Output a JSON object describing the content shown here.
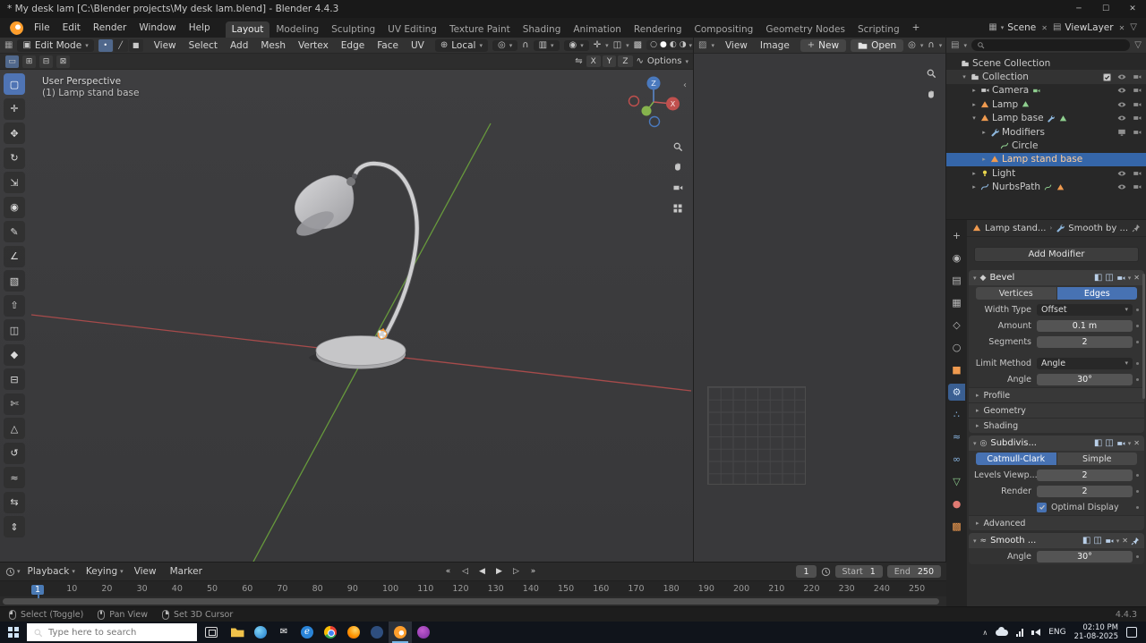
{
  "window": {
    "title": "* My desk lam [C:\\Blender projects\\My desk lam.blend] - Blender 4.4.3"
  },
  "glyphs": {
    "chevron": "▾",
    "expander-closed": "▸",
    "expander-open": "▾",
    "breadcrumb-sep": "›",
    "plus": "+",
    "close": "✕",
    "minimize": "─",
    "maximize": "☐",
    "panel-collapse": "‹",
    "caret-up": "∧",
    "filter": "▽",
    "editor-grid": "▦",
    "mode-cube": "▣",
    "vertex-mode": "•",
    "edge-mode": "╱",
    "face-mode": "■",
    "orientation": "⊕",
    "pivot": "◎",
    "magnet": "∩",
    "snap-target": "▥",
    "proportional": "◉",
    "gizmo": "✛",
    "overlays": "◫",
    "xray": "▩",
    "shade-wire": "○",
    "shade-solid": "●",
    "shade-material": "◐",
    "shade-render": "◑",
    "image-editor": "▨",
    "outliner-ic": "▤",
    "sel-new": "▭",
    "sel-extend": "⊞",
    "sel-subtract": "⊟",
    "sel-invert": "⊠",
    "mirror": "⇋",
    "snap-wave": "∿",
    "tab-tool": "+",
    "tab-render": "◉",
    "tab-output": "▤",
    "tab-view-layer": "▦",
    "tab-scene": "◇",
    "tab-world": "○",
    "tab-object": "■",
    "tab-modifiers": "⚙",
    "tab-particles": "∴",
    "tab-physics": "≈",
    "tab-constraints": "∞",
    "tab-data": "▽",
    "tab-material": "●",
    "tab-texture": "▩",
    "tool-box-select": "▢",
    "tool-cursor": "✛",
    "tool-move": "✥",
    "tool-rotate": "↻",
    "tool-scale": "⇲",
    "tool-transform": "◉",
    "tool-annotate": "✎",
    "tool-measure": "∠",
    "tool-add-cube": "▧",
    "tool-extrude": "⇧",
    "tool-inset": "◫",
    "tool-bevel": "◆",
    "tool-loop-cut": "⊟",
    "tool-knife": "✄",
    "tool-poly-build": "△",
    "tool-spin": "↺",
    "tool-smooth": "≈",
    "tool-edge-slide": "⇆",
    "tool-shrink": "⇕",
    "bevel-ic": "◆",
    "subdiv-ic": "◎",
    "smooth-ic": "≈",
    "header-display": "◧",
    "header-editmode": "◫"
  },
  "icon_map": {
    "scene-collection": "collection",
    "camera-data": "camera",
    "mesh-data": "mesh",
    "mesh-data-or": "mesh",
    "curve-data": "curve",
    "wrench-mod": "wrench"
  },
  "menubar": {
    "menus": [
      "File",
      "Edit",
      "Render",
      "Window",
      "Help"
    ],
    "workspaces": [
      {
        "label": "Layout",
        "name": "tab-layout",
        "active": true
      },
      {
        "label": "Modeling",
        "name": "tab-modeling"
      },
      {
        "label": "Sculpting",
        "name": "tab-sculpting"
      },
      {
        "label": "UV Editing",
        "name": "tab-uv-editing"
      },
      {
        "label": "Texture Paint",
        "name": "tab-texture-paint"
      },
      {
        "label": "Shading",
        "name": "tab-shading"
      },
      {
        "label": "Animation",
        "name": "tab-animation"
      },
      {
        "label": "Rendering",
        "name": "tab-rendering"
      },
      {
        "label": "Compositing",
        "name": "tab-compositing"
      },
      {
        "label": "Geometry Nodes",
        "name": "tab-geometry-nodes"
      },
      {
        "label": "Scripting",
        "name": "tab-scripting"
      }
    ],
    "new_workspace": "+",
    "scene": "Scene",
    "viewlayer": "ViewLayer"
  },
  "viewport": {
    "header": {
      "mode": "Edit Mode",
      "menus": [
        "View",
        "Select",
        "Add",
        "Mesh",
        "Vertex",
        "Edge",
        "Face",
        "UV"
      ],
      "orientation": "Local"
    },
    "tool_settings": {
      "axes": [
        "X",
        "Y",
        "Z"
      ],
      "options": "Options"
    },
    "overlay": {
      "line1": "User Perspective",
      "line2": "(1) Lamp stand base"
    },
    "gizmo": {
      "x": "X",
      "z": "Z"
    },
    "tools": [
      {
        "icon": "tool-box-select",
        "active": true
      },
      {
        "icon": "tool-cursor"
      },
      {
        "icon": "tool-move"
      },
      {
        "icon": "tool-rotate"
      },
      {
        "icon": "tool-scale"
      },
      {
        "icon": "tool-transform"
      },
      {
        "icon": "tool-annotate"
      },
      {
        "icon": "tool-measure"
      },
      {
        "icon": "tool-add-cube"
      },
      {
        "icon": "tool-extrude"
      },
      {
        "icon": "tool-inset"
      },
      {
        "icon": "tool-bevel"
      },
      {
        "icon": "tool-loop-cut"
      },
      {
        "icon": "tool-knife"
      },
      {
        "icon": "tool-poly-build"
      },
      {
        "icon": "tool-spin"
      },
      {
        "icon": "tool-smooth"
      },
      {
        "icon": "tool-edge-slide"
      },
      {
        "icon": "tool-shrink"
      }
    ]
  },
  "image_editor": {
    "menus": [
      "View",
      "Image"
    ],
    "new_button": "New",
    "open_button": "Open"
  },
  "outliner": {
    "rows": [
      {
        "label": "Scene Collection",
        "depth": 0,
        "icon": "scene-collection"
      },
      {
        "label": "Collection",
        "depth": 1,
        "exp": "▾",
        "icon": "collection",
        "check": true,
        "eye": true,
        "render": true,
        "highlight": true
      },
      {
        "label": "Camera",
        "depth": 2,
        "exp": "▸",
        "icon": "camera",
        "badge1": "camera-data",
        "eye": true,
        "render": true
      },
      {
        "label": "Lamp",
        "depth": 2,
        "exp": "▸",
        "icon": "mesh",
        "badge1": "mesh-data",
        "eye": true,
        "render": true
      },
      {
        "label": "Lamp base",
        "depth": 2,
        "exp": "▾",
        "icon": "mesh",
        "badge1": "wrench-mod",
        "badge2": "mesh-data",
        "eye": true,
        "render": true
      },
      {
        "label": "Modifiers",
        "depth": 3,
        "exp": "▸",
        "icon": "wrench",
        "screen": true,
        "render": true
      },
      {
        "label": "Circle",
        "depth": 4,
        "icon": "curve-data"
      },
      {
        "label": "Lamp stand base",
        "depth": 3,
        "exp": "▸",
        "icon": "mesh",
        "selected": true
      },
      {
        "label": "Light",
        "depth": 2,
        "exp": "▸",
        "icon": "light",
        "eye": true,
        "render": true
      },
      {
        "label": "NurbsPath",
        "depth": 2,
        "exp": "▸",
        "icon": "curve",
        "badge1": "curve-data",
        "badge2": "mesh-data-or",
        "eye": true,
        "render": true
      }
    ]
  },
  "properties": {
    "tabs": [
      {
        "icon": "tab-tool",
        "tint": "t-gray"
      },
      {
        "icon": "tab-render",
        "tint": "t-gray"
      },
      {
        "icon": "tab-output",
        "tint": "t-gray"
      },
      {
        "icon": "tab-view-layer",
        "tint": "t-gray"
      },
      {
        "icon": "tab-scene",
        "tint": "t-gray"
      },
      {
        "icon": "tab-world",
        "tint": "t-gray"
      },
      {
        "icon": "tab-object",
        "tint": "t-orange"
      },
      {
        "icon": "tab-modifiers",
        "tint": "t-blue",
        "active": true
      },
      {
        "icon": "tab-particles",
        "tint": "t-blue"
      },
      {
        "icon": "tab-physics",
        "tint": "t-blue"
      },
      {
        "icon": "tab-constraints",
        "tint": "t-blue"
      },
      {
        "icon": "tab-data",
        "tint": "t-green"
      },
      {
        "icon": "tab-material",
        "tint": "t-red"
      },
      {
        "icon": "tab-texture",
        "tint": "t-orange"
      }
    ],
    "breadcrumb": {
      "object": "Lamp stand...",
      "modifier": "Smooth by ..."
    },
    "add_modifier": "Add Modifier",
    "bevel": {
      "name": "Bevel",
      "vertices": "Vertices",
      "edges": "Edges",
      "width_type_label": "Width Type",
      "width_type": "Offset",
      "amount_label": "Amount",
      "amount": "0.1 m",
      "segments_label": "Segments",
      "segments": "2",
      "limit_label": "Limit Method",
      "limit": "Angle",
      "angle_label": "Angle",
      "angle": "30°",
      "sections": [
        "Profile",
        "Geometry",
        "Shading"
      ]
    },
    "subdivision": {
      "name": "Subdivis...",
      "catmull": "Catmull-Clark",
      "simple": "Simple",
      "levels_label": "Levels Viewp...",
      "levels": "2",
      "render_label": "Render",
      "render": "2",
      "optimal": "Optimal Display",
      "advanced": "Advanced"
    },
    "smooth": {
      "name": "Smooth ...",
      "angle_label": "Angle",
      "angle": "30°"
    }
  },
  "timeline": {
    "menus": [
      {
        "label": "Playback",
        "chev": "▾"
      },
      {
        "label": "Keying",
        "chev": "▾"
      },
      {
        "label": "View"
      },
      {
        "label": "Marker"
      }
    ],
    "transport": [
      {
        "name": "jump-to-start-button",
        "glyph": "«"
      },
      {
        "name": "prev-keyframe-button",
        "glyph": "◁"
      },
      {
        "name": "play-reverse-button",
        "glyph": "◀"
      },
      {
        "name": "play-button",
        "glyph": "▶"
      },
      {
        "name": "next-keyframe-button",
        "glyph": "▷"
      },
      {
        "name": "jump-to-end-button",
        "glyph": "»"
      }
    ],
    "current_frame": "1",
    "start_label": "Start",
    "start": "1",
    "end_label": "End",
    "end": "250",
    "ticks": [
      {
        "label": "1",
        "current": true
      },
      {
        "label": "10"
      },
      {
        "label": "20"
      },
      {
        "label": "30"
      },
      {
        "label": "40"
      },
      {
        "label": "50"
      },
      {
        "label": "60"
      },
      {
        "label": "70"
      },
      {
        "label": "80"
      },
      {
        "label": "90"
      },
      {
        "label": "100"
      },
      {
        "label": "110"
      },
      {
        "label": "120"
      },
      {
        "label": "130"
      },
      {
        "label": "140"
      },
      {
        "label": "150"
      },
      {
        "label": "160"
      },
      {
        "label": "170"
      },
      {
        "label": "180"
      },
      {
        "label": "190"
      },
      {
        "label": "200"
      },
      {
        "label": "210"
      },
      {
        "label": "220"
      },
      {
        "label": "230"
      },
      {
        "label": "240"
      },
      {
        "label": "250"
      }
    ]
  },
  "status_bar": {
    "items": [
      {
        "label": "Select (Toggle)",
        "btn": "l"
      },
      {
        "label": "Pan View",
        "btn": "m"
      },
      {
        "label": "Set 3D Cursor",
        "btn": "r"
      }
    ],
    "version": "4.4.3"
  },
  "taskbar": {
    "search_placeholder": "Type here to search",
    "apps": [
      {
        "name": "file-explorer-app",
        "cls": "app-folder"
      },
      {
        "name": "edge-app",
        "cls": "app-edge"
      },
      {
        "name": "mail-app",
        "cls": "app-mail",
        "glyph": "✉"
      },
      {
        "name": "browser-app",
        "cls": "app-ie",
        "glyph": "e"
      },
      {
        "name": "chrome-app",
        "cls": "app-chrome"
      },
      {
        "name": "firefox-app",
        "cls": "app-firefox"
      },
      {
        "name": "app-7",
        "cls": "app-navy"
      },
      {
        "name": "blender-app",
        "cls": "app-blender",
        "active": true
      },
      {
        "name": "app-9",
        "cls": "app-purple"
      }
    ],
    "tray": {
      "lang": "ENG",
      "time": "02:10 PM",
      "date": "21-08-2025"
    }
  }
}
